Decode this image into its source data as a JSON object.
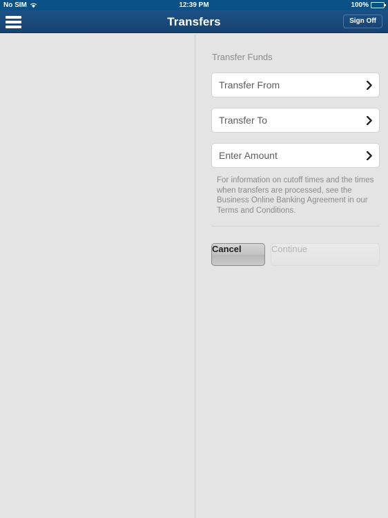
{
  "status_bar": {
    "carrier": "No SIM",
    "wifi_icon": "wifi-icon",
    "time": "12:39 PM",
    "battery_percent": "100%",
    "battery_icon": "battery-full-icon"
  },
  "nav_bar": {
    "menu_icon": "hamburger-menu-icon",
    "title": "Transfers",
    "sign_off_label": "Sign Off"
  },
  "transfer_panel": {
    "section_title": "Transfer Funds",
    "fields": [
      {
        "label": "Transfer From",
        "chevron_icon": "chevron-right-icon"
      },
      {
        "label": "Transfer To",
        "chevron_icon": "chevron-right-icon"
      },
      {
        "label": "Enter Amount",
        "chevron_icon": "chevron-right-icon"
      }
    ],
    "disclaimer": "For information on cutoff times and the times when transfers are processed, see the Business Online Banking Agreement in our Terms and Conditions.",
    "cancel_label": "Cancel",
    "continue_label": "Continue"
  },
  "colors": {
    "nav_blue_top": "#1d5187",
    "nav_blue_bottom": "#154271",
    "status_blue": "#0a5286",
    "background_gray": "#e4e4e4",
    "field_white": "#ffffff",
    "text_gray": "#8a8a8a"
  }
}
